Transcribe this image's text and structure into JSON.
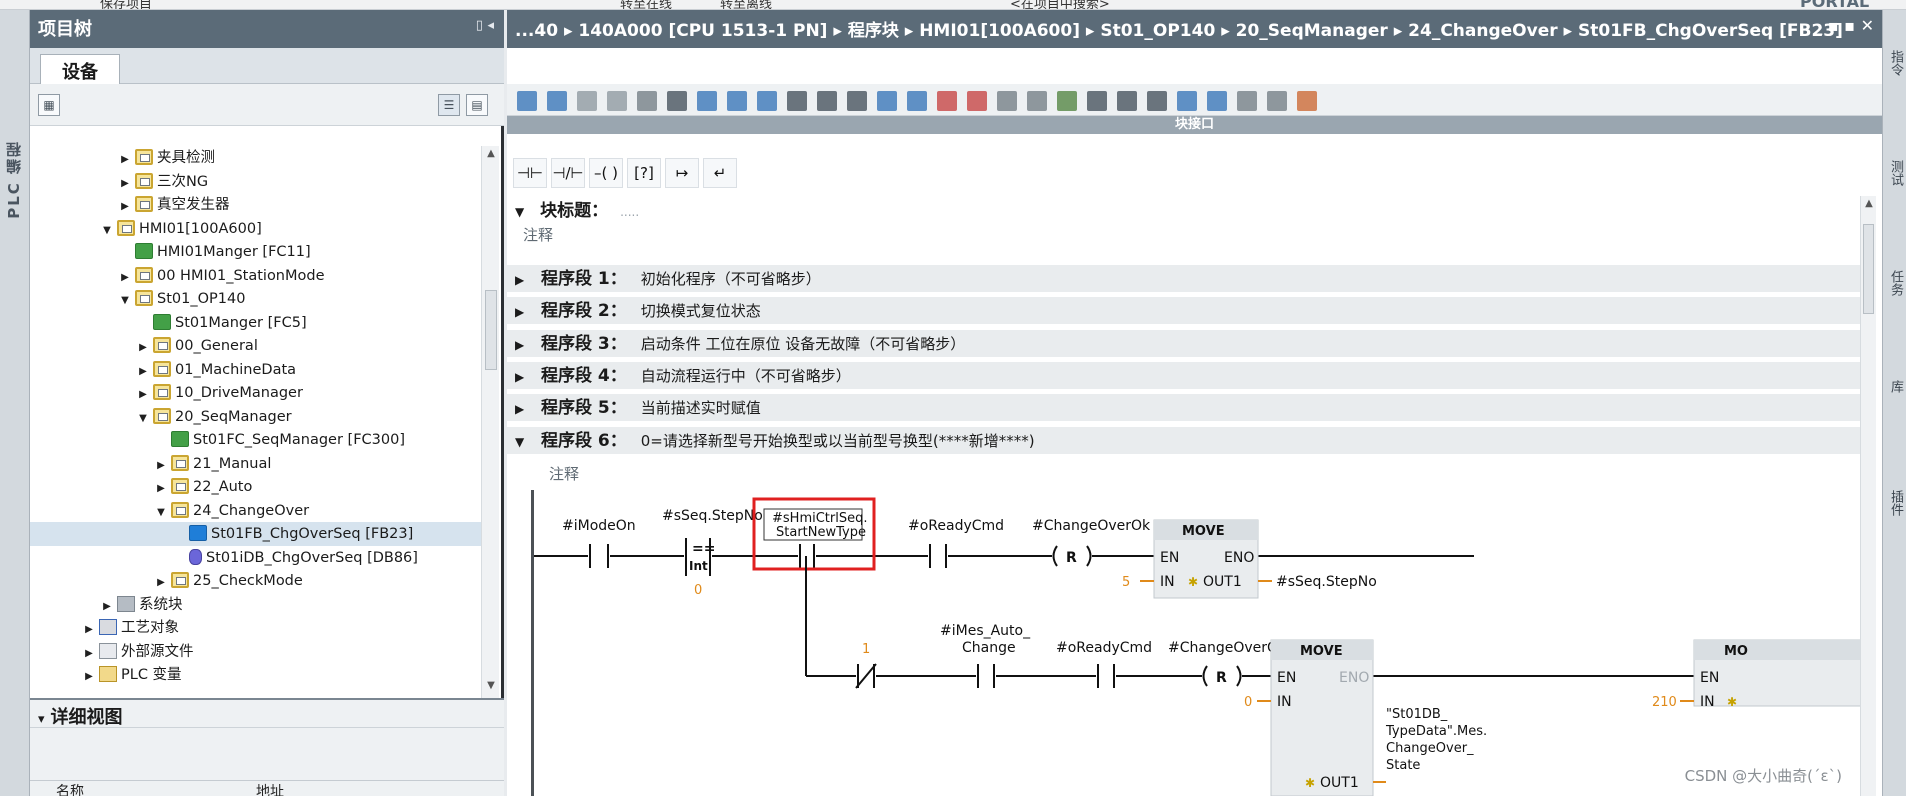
{
  "top_toolbar": {
    "items": [
      "保存项目",
      "转至在线",
      "转至离线",
      "<在项目中搜索>"
    ],
    "brand": "PORTAL"
  },
  "left_sidetab": {
    "label": "PLC 编程"
  },
  "tree": {
    "title": "项目树",
    "tab": "设备",
    "rows": [
      {
        "label": "夹具检测",
        "depth": 5,
        "twisty": "closed",
        "icon": "folder"
      },
      {
        "label": "三次NG",
        "depth": 5,
        "twisty": "closed",
        "icon": "folder"
      },
      {
        "label": "真空发生器",
        "depth": 5,
        "twisty": "closed",
        "icon": "folder"
      },
      {
        "label": "HMI01[100A600]",
        "depth": 4,
        "twisty": "open",
        "icon": "folder"
      },
      {
        "label": "HMI01Manger [FC11]",
        "depth": 5,
        "twisty": "none",
        "icon": "block"
      },
      {
        "label": "00 HMI01_StationMode",
        "depth": 5,
        "twisty": "closed",
        "icon": "folder"
      },
      {
        "label": "St01_OP140",
        "depth": 5,
        "twisty": "open",
        "icon": "folder"
      },
      {
        "label": "St01Manger [FC5]",
        "depth": 6,
        "twisty": "none",
        "icon": "block"
      },
      {
        "label": "00_General",
        "depth": 6,
        "twisty": "closed",
        "icon": "folder"
      },
      {
        "label": "01_MachineData",
        "depth": 6,
        "twisty": "closed",
        "icon": "folder"
      },
      {
        "label": "10_DriveManager",
        "depth": 6,
        "twisty": "closed",
        "icon": "folder"
      },
      {
        "label": "20_SeqManager",
        "depth": 6,
        "twisty": "open",
        "icon": "folder"
      },
      {
        "label": "St01FC_SeqManager [FC300]",
        "depth": 7,
        "twisty": "none",
        "icon": "block"
      },
      {
        "label": "21_Manual",
        "depth": 7,
        "twisty": "closed",
        "icon": "folder"
      },
      {
        "label": "22_Auto",
        "depth": 7,
        "twisty": "closed",
        "icon": "folder"
      },
      {
        "label": "24_ChangeOver",
        "depth": 7,
        "twisty": "open",
        "icon": "folder"
      },
      {
        "label": "St01FB_ChgOverSeq [FB23]",
        "depth": 8,
        "twisty": "none",
        "icon": "fb",
        "selected": true
      },
      {
        "label": "St01iDB_ChgOverSeq [DB86]",
        "depth": 8,
        "twisty": "none",
        "icon": "db"
      },
      {
        "label": "25_CheckMode",
        "depth": 7,
        "twisty": "closed",
        "icon": "folder"
      },
      {
        "label": "系统块",
        "depth": 4,
        "twisty": "closed",
        "icon": "sys"
      },
      {
        "label": "工艺对象",
        "depth": 3,
        "twisty": "closed",
        "icon": "tech"
      },
      {
        "label": "外部源文件",
        "depth": 3,
        "twisty": "closed",
        "icon": "ext"
      },
      {
        "label": "PLC 变量",
        "depth": 3,
        "twisty": "closed",
        "icon": "plcvar"
      }
    ]
  },
  "detail": {
    "title": "详细视图",
    "col_name": "名称",
    "col_address": "地址"
  },
  "editor": {
    "breadcrumb": "...40 ▸ 140A000 [CPU 1513-1 PN] ▸ 程序块 ▸ HMI01[100A600] ▸ St01_OP140 ▸ 20_SeqManager ▸ 24_ChangeOver ▸ St01FB_ChgOverSeq [FB23]",
    "window_buttons": "_ ▪ ▪ ✕",
    "interface_bar": "块接口",
    "block_title_label": "块标题：",
    "block_title_value": ".....",
    "block_comment": "注释",
    "segments": [
      {
        "name": "程序段 1：",
        "desc": "初始化程序（不可省略步）",
        "open": false
      },
      {
        "name": "程序段 2：",
        "desc": "切换模式复位状态",
        "open": false
      },
      {
        "name": "程序段 3：",
        "desc": "启动条件 工位在原位 设备无故障（不可省略步）",
        "open": false
      },
      {
        "name": "程序段 4：",
        "desc": "自动流程运行中（不可省略步）",
        "open": false
      },
      {
        "name": "程序段 5：",
        "desc": "当前描述实时赋值",
        "open": false
      },
      {
        "name": "程序段 6：",
        "desc": "0=请选择新型号开始换型或以当前型号换型(****新增****)",
        "open": true
      }
    ],
    "segment_comment": "注释"
  },
  "ladder": {
    "rung1": {
      "c1": "#iModeOn",
      "cmp_tag": "#sSeq.StepNo",
      "cmp_op": "==",
      "cmp_type": "Int",
      "cmp_value": "0",
      "c3_line1": "#sHmiCtrlSeq.",
      "c3_line2": "StartNewType",
      "c4": "#oReadyCmd",
      "coil": "#ChangeOverOk",
      "coil_type": "R",
      "move_title": "MOVE",
      "move_en": "EN",
      "move_eno": "ENO",
      "move_in": "IN",
      "move_out": "OUT1",
      "in_value": "5",
      "out_tag": "#sSeq.StepNo"
    },
    "rung2": {
      "nc_label": "1",
      "c2_line1": "#iMes_Auto_",
      "c2_line2": "Change",
      "c3": "#oReadyCmd",
      "coil": "#ChangeOverOk",
      "coil_type": "R",
      "move_title": "MOVE",
      "move_en": "EN",
      "move_eno": "ENO",
      "move_in": "IN",
      "move_out": "OUT1",
      "in_value": "0",
      "out_line1": "\"St01DB_",
      "out_line2": "TypeData\".Mes.",
      "out_line3": "ChangeOver_",
      "out_line4": "State",
      "move2_title": "MO",
      "move2_en": "EN",
      "move2_in": "IN",
      "move2_value": "210"
    }
  },
  "right_sidetabs": [
    "指令",
    "测试",
    "任务",
    "库",
    "插件"
  ],
  "watermark": "CSDN @大小曲奇(´ε`)",
  "colors": {
    "header": "#5b6b78",
    "highlight_box": "#e02020",
    "value_orange": "#e08a1a"
  }
}
